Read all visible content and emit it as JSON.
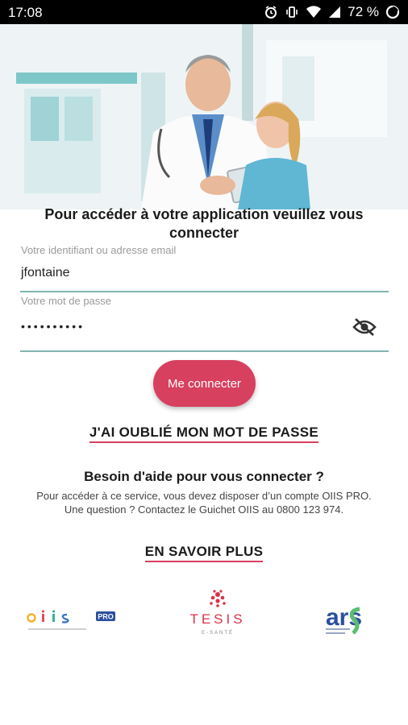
{
  "status_bar": {
    "time": "17:08",
    "battery_percent": "72 %",
    "icons": [
      "alarm-icon",
      "vibrate-icon",
      "wifi-icon",
      "signal-icon",
      "battery-icon"
    ]
  },
  "login": {
    "title": "Pour accéder à votre application veuillez vous connecter",
    "username_label": "Votre identifiant ou adresse email",
    "username_value": "jfontaine",
    "password_label": "Votre mot de passe",
    "password_value": "••••••••••",
    "submit_label": "Me connecter",
    "forgot_link": "J'AI OUBLIÉ MON MOT DE PASSE"
  },
  "help": {
    "title": "Besoin d'aide pour vous connecter ?",
    "line1": "Pour accéder à ce service, vous devez disposer d’un compte OIIS PRO.",
    "line2": "Une question ? Contactez le Guichet OIIS au 0800 123 974.",
    "more_link": "EN SAVOIR PLUS"
  },
  "logos": {
    "oiis": "oiis",
    "oiis_badge": "PRO",
    "tesis": "TESIS",
    "tesis_sub": "E-SANTÉ",
    "ars": "ars"
  },
  "colors": {
    "accent": "#d7405f",
    "underline": "#7fb3b0",
    "status_bar": "#000000"
  }
}
